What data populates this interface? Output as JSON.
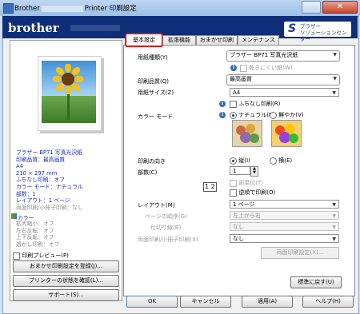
{
  "window": {
    "title_prefix": "Brother",
    "title_suffix": "Printer 印刷設定",
    "close_glyph": "✕"
  },
  "header": {
    "logo": "brother",
    "solutions_line1": "ブラザー",
    "solutions_line2": "ソリューションセンター"
  },
  "tabs": [
    "基本設定",
    "拡張機能",
    "おまかせ印刷",
    "メンテナンス"
  ],
  "summary": {
    "lines": [
      "ブラザー BP71 写真光沢紙",
      "印刷品質：最高画質",
      "A4",
      "210 × 297 mm",
      "ふちなし印刷：オフ",
      "カラー モード：ナチュラル",
      "部数：1",
      "レイアウト：1 ページ"
    ],
    "gray_line": "両面印刷/小冊子印刷：なし",
    "color_header": "カラー",
    "color_lines": [
      "拡大縮小：オフ",
      "左右反転：オフ",
      "上下反転：オフ",
      "透かし印刷：オフ"
    ]
  },
  "left_controls": {
    "preview_label": "印刷プレビュー(P)",
    "register_label": "おまかせ印刷設定を登録(J)...",
    "status_label": "プリンターの状態を確認(L)...",
    "support_label": "サポート(S)..."
  },
  "form": {
    "media_label": "用紙種類(Y)",
    "media_value": "ブラザー BP71 写真光沢紙",
    "slow_dry_label": "乾きにくい紙(W)",
    "quality_label": "印刷品質(Q)",
    "quality_value": "最高画質",
    "size_label": "用紙サイズ(Z)",
    "size_value": "A4",
    "borderless_label": "ふちなし印刷(R)",
    "color_mode_label": "カラー モード",
    "color_natural_label": "ナチュラル(N)",
    "color_vivid_label": "鮮やか(V)",
    "orientation_label": "印刷の向き",
    "portrait_label": "縦(I)",
    "landscape_label": "横(E)",
    "copies_label": "部数(C)",
    "copies_value": "1",
    "collate_label": "部単位(T)",
    "reverse_label": "逆順で印刷(O)",
    "layout_label": "レイアウト(M)",
    "layout_value": "1 ページ",
    "page_order_label": "ページの順序(G)",
    "page_order_value": "左上から右",
    "border_label": "仕切り線(B)",
    "border_value": "なし",
    "duplex_label": "両面印刷/小冊子印刷(X)",
    "duplex_value": "なし",
    "duplex_settings_label": "両面印刷設定(X)...",
    "default_label": "標準に戻す(U)",
    "info_glyph": "i",
    "arrow_glyph": "▼",
    "layout_icon_text": "1 2"
  },
  "footer": {
    "ok": "OK",
    "cancel": "キャンセル",
    "apply": "適用(A)",
    "help": "ヘルプ(H)"
  },
  "colors": {
    "header_bg": "#0e2e7a",
    "highlight": "#e00000",
    "info_text": "#1a2db5"
  }
}
